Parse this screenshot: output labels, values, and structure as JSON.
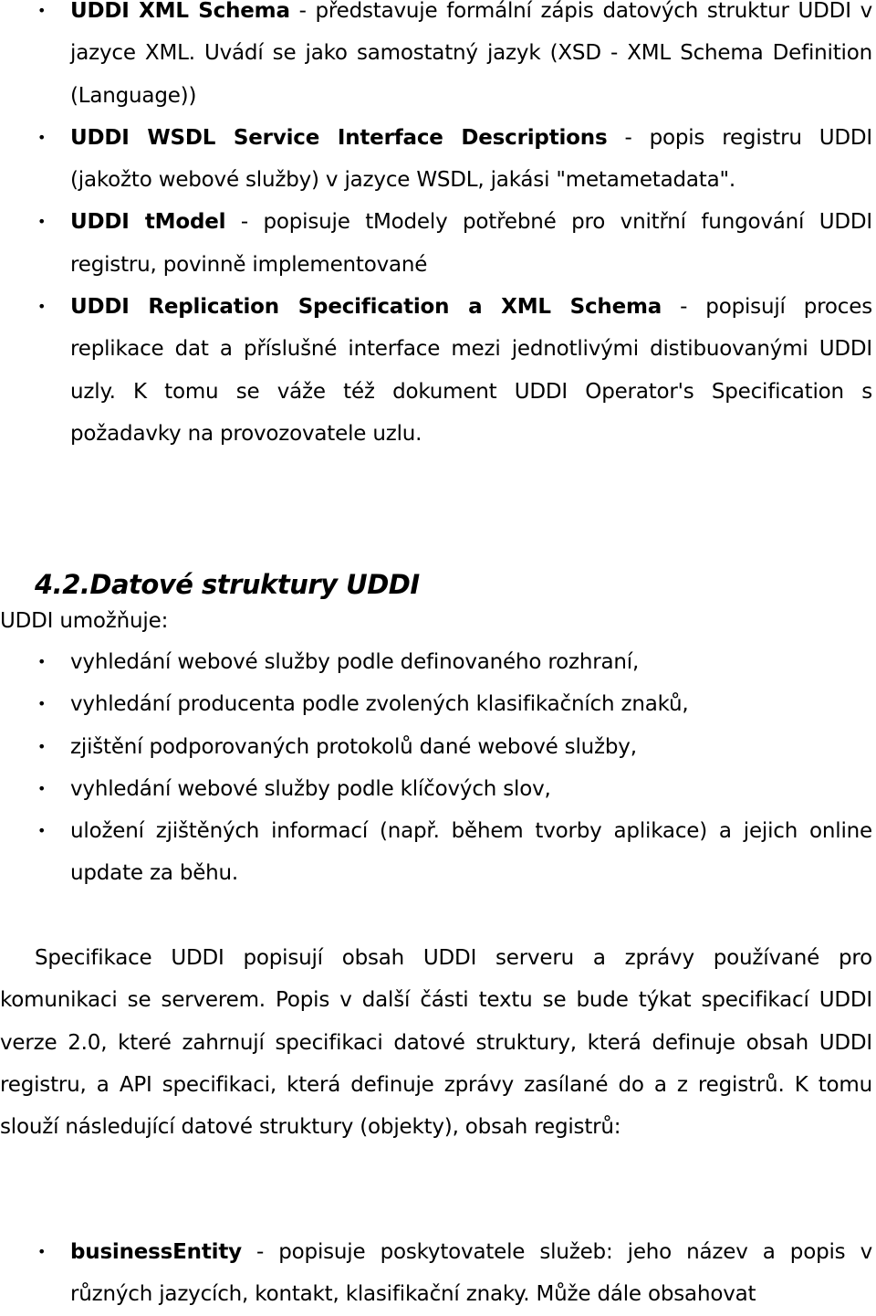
{
  "top_list": [
    {
      "term": "UDDI XML Schema",
      "text": " - představuje formální zápis datových struktur UDDI v jazyce XML. Uvádí se jako samostatný jazyk (XSD - XML Schema Definition (Language))"
    },
    {
      "term": "UDDI WSDL Service Interface Descriptions",
      "text": " - popis registru UDDI (jakožto webové služby) v jazyce WSDL, jakási \"metametadata\"."
    },
    {
      "term": "UDDI tModel",
      "text": " - popisuje tModely potřebné pro vnitřní fungování UDDI registru, povinně implementované"
    },
    {
      "term": "UDDI Replication Specification a XML Schema",
      "text": " - popisují proces replikace dat a příslušné interface mezi jednotlivými distibuovanými UDDI uzly. K tomu se váže též dokument UDDI Operator's Specification s požadavky na provozovatele uzlu."
    }
  ],
  "section": {
    "heading": "4.2.Datové struktury UDDI",
    "intro": "UDDI umožňuje:",
    "capabilities": [
      "vyhledání webové služby podle definovaného rozhraní,",
      "vyhledání producenta podle zvolených klasifikačních znaků,",
      "zjištění podporovaných protokolů dané webové služby,",
      "vyhledání webové služby podle klíčových slov,",
      "uložení zjištěných informací (např. během tvorby aplikace) a jejich online update za běhu."
    ],
    "paragraph": "Specifikace UDDI popisují obsah UDDI serveru a zprávy používané pro komunikaci se serverem. Popis v další části textu se bude týkat specifikací UDDI verze 2.0, které zahrnují specifikaci datové struktury, která definuje obsah UDDI registru, a API specifikaci, která definuje zprávy zasílané do a z registrů. K tomu slouží následující datové struktury (objekty), obsah registrů:",
    "structures": [
      {
        "term": "businessEntity",
        "text": " - popisuje poskytovatele služeb: jeho název a popis v různých jazycích, kontakt, klasifikační znaky. Může dále obsahovat"
      }
    ]
  },
  "bullet_glyph": "•"
}
